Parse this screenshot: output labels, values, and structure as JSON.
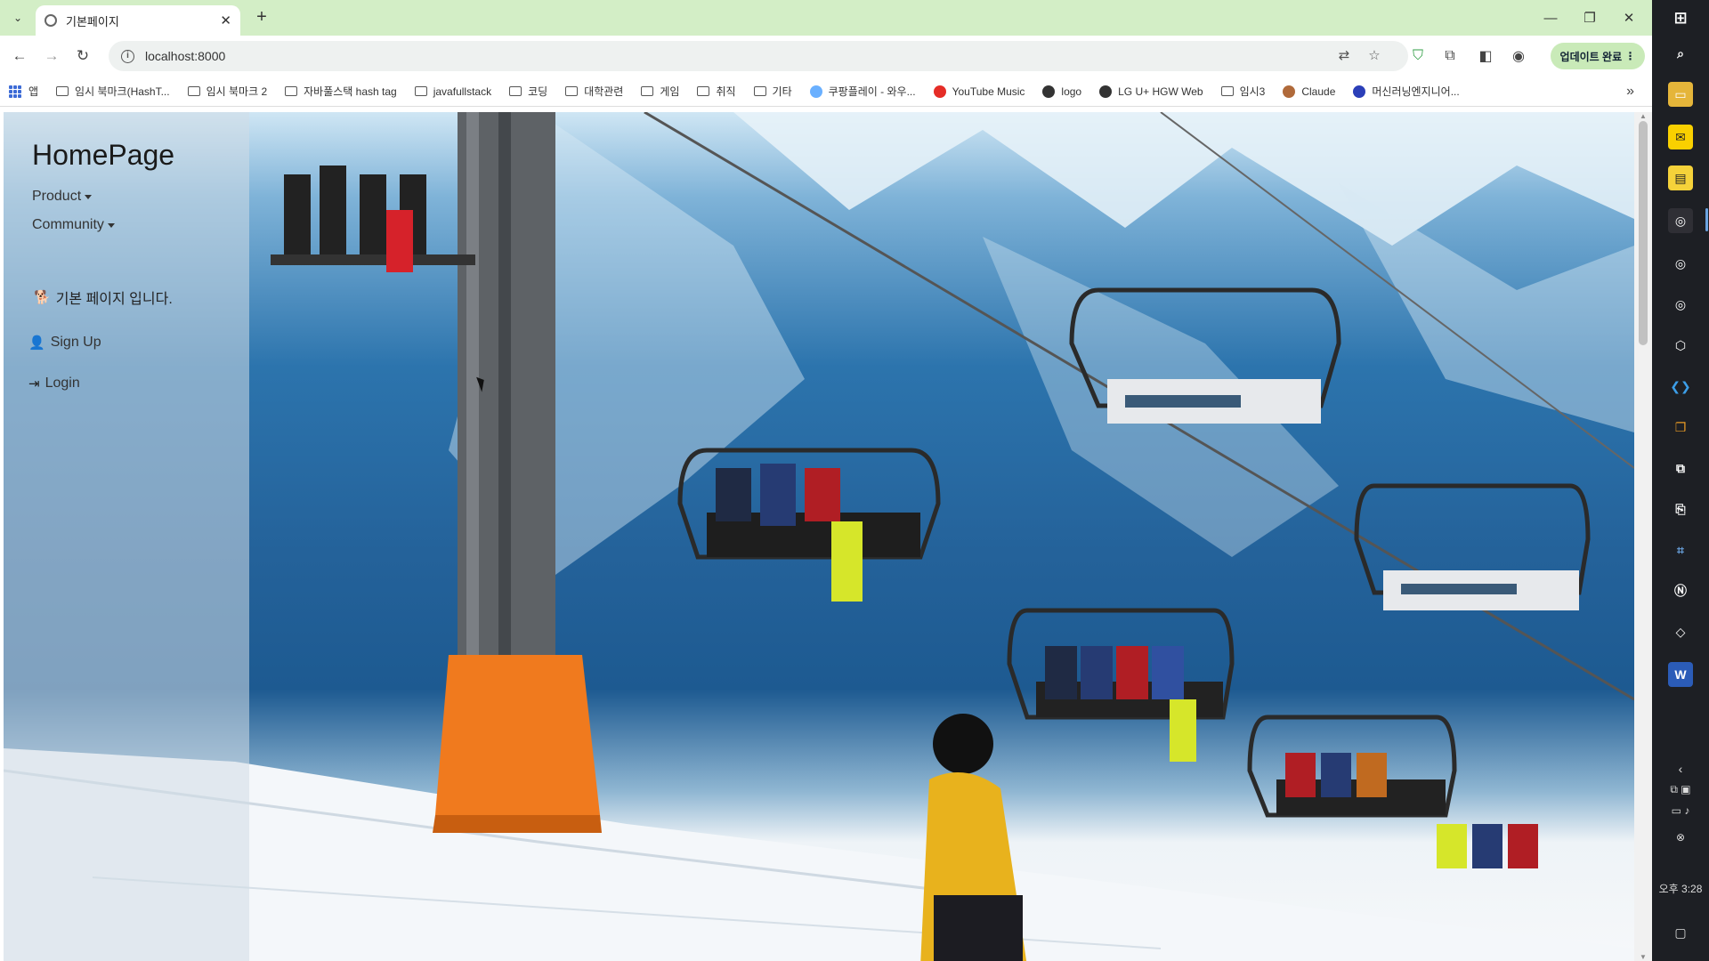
{
  "browser": {
    "tab": {
      "title": "기본페이지"
    },
    "address": {
      "url": "localhost:8000"
    },
    "update_label": "업데이트 완료",
    "bookmarks": [
      {
        "label": "앱",
        "icon": "apps-icon"
      },
      {
        "label": "임시 북마크(HashT...",
        "icon": "folder-icon"
      },
      {
        "label": "임시 북마크 2",
        "icon": "folder-icon"
      },
      {
        "label": "자바풀스택 hash tag",
        "icon": "folder-icon"
      },
      {
        "label": "javafullstack",
        "icon": "folder-icon"
      },
      {
        "label": "코딩",
        "icon": "folder-icon"
      },
      {
        "label": "대학관련",
        "icon": "folder-icon"
      },
      {
        "label": "게임",
        "icon": "folder-icon"
      },
      {
        "label": "취직",
        "icon": "folder-icon"
      },
      {
        "label": "기타",
        "icon": "folder-icon"
      },
      {
        "label": "쿠팡플레이 - 와우...",
        "icon": "coupang-play-icon"
      },
      {
        "label": "YouTube Music",
        "icon": "youtube-music-icon"
      },
      {
        "label": "logo",
        "icon": "globe-icon"
      },
      {
        "label": "LG U+ HGW Web",
        "icon": "globe-icon"
      },
      {
        "label": "임시3",
        "icon": "folder-icon"
      },
      {
        "label": "Claude",
        "icon": "claude-icon"
      },
      {
        "label": "머신러닝엔지니어...",
        "icon": "j-icon"
      }
    ]
  },
  "page": {
    "brand": "HomePage",
    "menu": {
      "product": "Product",
      "community": "Community"
    },
    "intro": "기본 페이지 입니다.",
    "signup": "Sign Up",
    "login": "Login"
  },
  "taskbar": {
    "clock": "오후 3:28"
  },
  "colors": {
    "tabstrip": "#d3eec6",
    "taskbar": "#1d1f24",
    "sidebar_overlay": "rgba(210,220,230,0.55)",
    "jacket": "#e8b21d"
  }
}
